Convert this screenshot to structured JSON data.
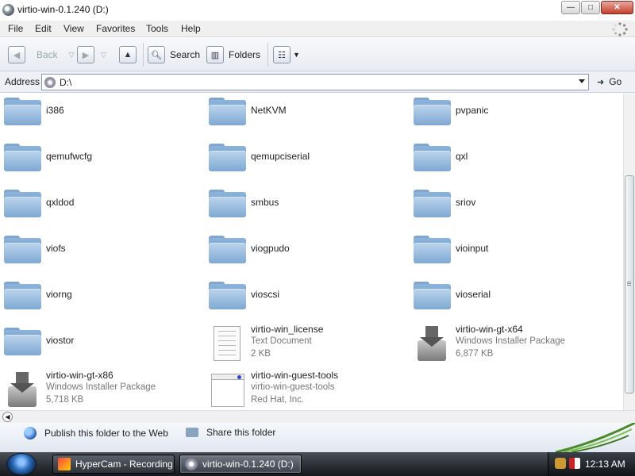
{
  "window": {
    "title": "virtio-win-0.1.240 (D:)",
    "buttons": {
      "minimize": "—",
      "maximize": "□",
      "close": "✕"
    }
  },
  "menu": [
    "File",
    "Edit",
    "View",
    "Favorites",
    "Tools",
    "Help"
  ],
  "toolbar": {
    "back": "Back",
    "search": "Search",
    "folders": "Folders"
  },
  "address": {
    "label": "Address",
    "value": "D:\\",
    "go": "Go"
  },
  "items": [
    {
      "name": "i386",
      "kind": "folder"
    },
    {
      "name": "NetKVM",
      "kind": "folder"
    },
    {
      "name": "pvpanic",
      "kind": "folder"
    },
    {
      "name": "qemufwcfg",
      "kind": "folder"
    },
    {
      "name": "qemupciserial",
      "kind": "folder"
    },
    {
      "name": "qxl",
      "kind": "folder"
    },
    {
      "name": "qxldod",
      "kind": "folder"
    },
    {
      "name": "smbus",
      "kind": "folder"
    },
    {
      "name": "sriov",
      "kind": "folder"
    },
    {
      "name": "viofs",
      "kind": "folder"
    },
    {
      "name": "viogpudo",
      "kind": "folder"
    },
    {
      "name": "vioinput",
      "kind": "folder"
    },
    {
      "name": "viorng",
      "kind": "folder"
    },
    {
      "name": "vioscsi",
      "kind": "folder"
    },
    {
      "name": "vioserial",
      "kind": "folder"
    },
    {
      "name": "viostor",
      "kind": "folder"
    },
    {
      "name": "virtio-win_license",
      "kind": "text",
      "type": "Text Document",
      "size": "2 KB"
    },
    {
      "name": "virtio-win-gt-x64",
      "kind": "msi",
      "type": "Windows Installer Package",
      "size": "6,877 KB"
    },
    {
      "name": "virtio-win-gt-x86",
      "kind": "msi",
      "type": "Windows Installer Package",
      "size": "5,718 KB"
    },
    {
      "name": "virtio-win-guest-tools",
      "kind": "app",
      "type": "virtio-win-guest-tools",
      "size": "Red Hat, Inc."
    }
  ],
  "tasks": {
    "publish": "Publish this folder to the Web",
    "share": "Share this folder"
  },
  "taskbar": {
    "buttons": [
      "HyperCam - Recording",
      "virtio-win-0.1.240 (D:)"
    ],
    "clock": "12:13 AM"
  }
}
